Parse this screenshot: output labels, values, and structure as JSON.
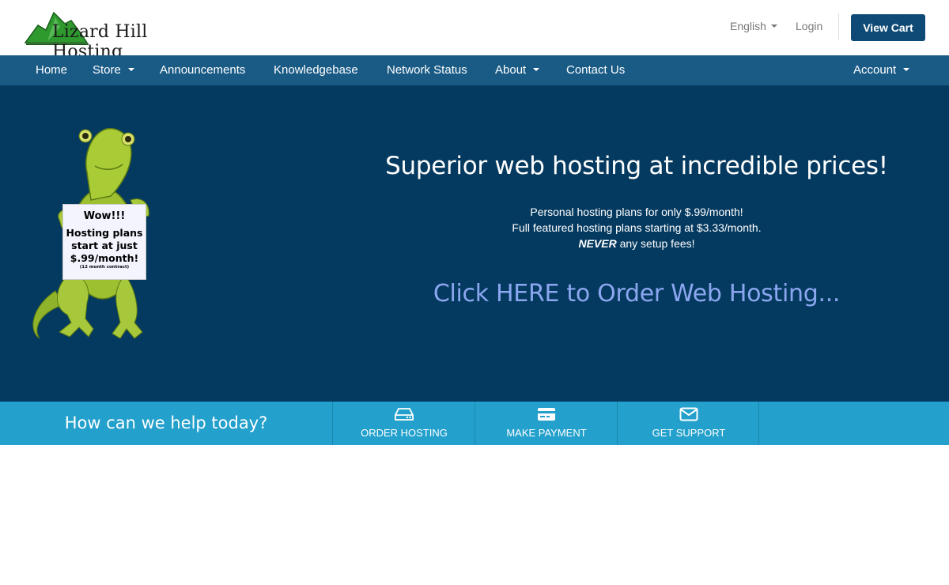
{
  "brand": {
    "name": "Lizard Hill Hosting",
    "colors": {
      "primary": "#0e4a75",
      "nav": "#1a5b86",
      "hero_bg": "#053a60",
      "help_bar": "#23a0cb",
      "cta": "#8ba7f0",
      "logo_green": "#2e9a2e"
    }
  },
  "header": {
    "language": "English",
    "login": "Login",
    "view_cart": "View Cart"
  },
  "nav": {
    "items": [
      {
        "label": "Home",
        "dropdown": false
      },
      {
        "label": "Store",
        "dropdown": true
      },
      {
        "label": "Announcements",
        "dropdown": false
      },
      {
        "label": "Knowledgebase",
        "dropdown": false
      },
      {
        "label": "Network Status",
        "dropdown": false
      },
      {
        "label": "About",
        "dropdown": true
      },
      {
        "label": "Contact Us",
        "dropdown": false
      }
    ],
    "account": "Account"
  },
  "hero": {
    "sign": {
      "line1": "Wow!!!",
      "line2": "Hosting plans",
      "line3": "start at just",
      "line4": "$.99/month!",
      "line5": "(12 month contract)"
    },
    "title": "Superior web hosting at incredible prices!",
    "line1": "Personal hosting plans for only $.99/month!",
    "line2": "Full featured hosting plans starting at $3.33/month.",
    "line3_em": "NEVER",
    "line3_rest": " any setup fees!",
    "cta": "Click HERE to Order Web Hosting..."
  },
  "help": {
    "title": "How can we help today?",
    "buttons": [
      {
        "label": "ORDER HOSTING",
        "icon": "server-icon"
      },
      {
        "label": "MAKE PAYMENT",
        "icon": "credit-card-icon"
      },
      {
        "label": "GET SUPPORT",
        "icon": "envelope-icon"
      }
    ]
  }
}
